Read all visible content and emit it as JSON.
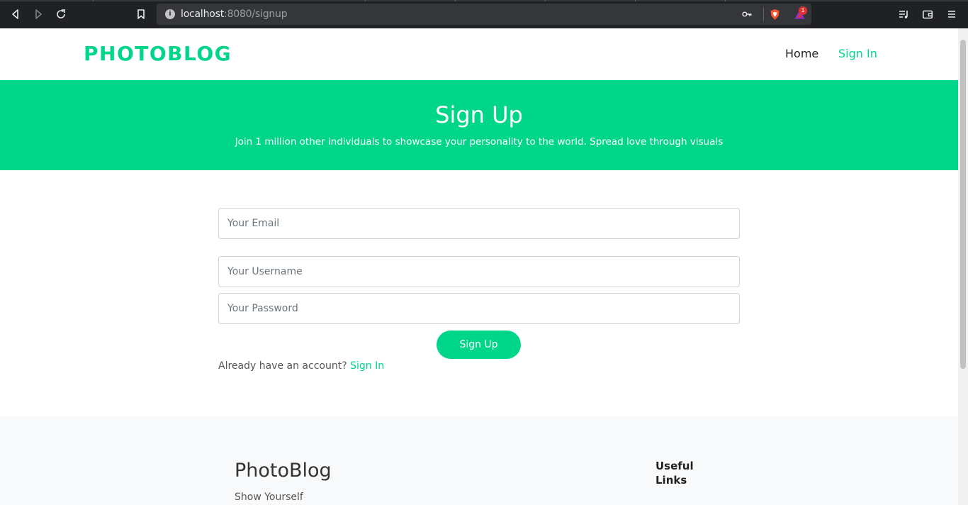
{
  "browser": {
    "url_host": "localhost",
    "url_path": ":8080/signup",
    "brave_badge_count": "1",
    "icons": [
      "back-icon",
      "forward-icon",
      "reload-icon",
      "bookmark-icon",
      "info-icon",
      "key-icon",
      "brave-shield-icon",
      "brave-rewards-icon",
      "playlist-icon",
      "wallet-icon",
      "menu-icon"
    ]
  },
  "header": {
    "logo": "PHOTOBLOG",
    "nav": [
      {
        "label": "Home"
      },
      {
        "label": "Sign In"
      }
    ]
  },
  "hero": {
    "title": "Sign Up",
    "subtitle": "Join 1 million other individuals to showcase your personality to the world. Spread love through visuals"
  },
  "form": {
    "email_placeholder": "Your Email",
    "username_placeholder": "Your Username",
    "password_placeholder": "Your Password",
    "submit_label": "Sign Up",
    "already_text": "Already have an account?",
    "signin_link": "Sign In"
  },
  "footer": {
    "brand": "PhotoBlog",
    "tagline": "Show Yourself",
    "useful_links_heading": "Useful Links"
  },
  "colors": {
    "accent": "#00d68a",
    "chrome_bg": "#202124"
  }
}
